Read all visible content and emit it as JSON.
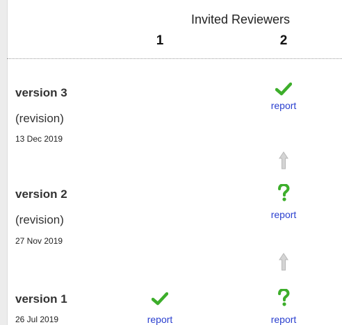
{
  "header": {
    "title": "Invited Reviewers",
    "columns": [
      "1",
      "2"
    ]
  },
  "colors": {
    "approved": "#3dae2b",
    "question": "#3dae2b",
    "link": "#2a3fcf",
    "arrow": "#bdbdbd"
  },
  "versions": [
    {
      "label": "version 3",
      "note": "(revision)",
      "date": "13 Dec 2019",
      "reviews": [
        null,
        {
          "status": "check-icon",
          "link": "report"
        }
      ]
    },
    {
      "label": "version 2",
      "note": "(revision)",
      "date": "27 Nov 2019",
      "reviews": [
        null,
        {
          "status": "question-icon",
          "link": "report"
        }
      ]
    },
    {
      "label": "version 1",
      "note": "",
      "date": "26 Jul 2019",
      "reviews": [
        {
          "status": "check-icon",
          "link": "report"
        },
        {
          "status": "question-icon",
          "link": "report"
        }
      ]
    }
  ]
}
